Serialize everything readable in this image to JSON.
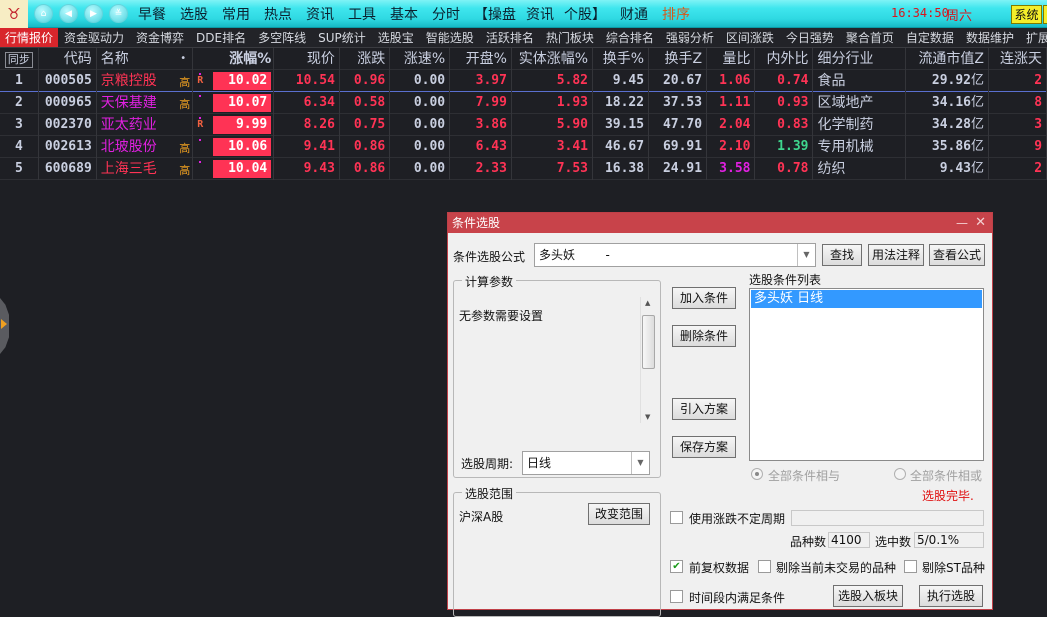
{
  "topbar": {
    "logo_icon": "bull-logo-icon",
    "nav_buttons": [
      {
        "icon": "home-icon",
        "glyph": "⌂"
      },
      {
        "icon": "back-icon",
        "glyph": "◀"
      },
      {
        "icon": "forward-icon",
        "glyph": "▶"
      },
      {
        "icon": "expand-down-icon",
        "glyph": "≚"
      }
    ],
    "menu": [
      "早餐",
      "选股",
      "常用",
      "热点",
      "资讯",
      "工具",
      "基本",
      "分时",
      "【操盘",
      "资讯",
      "个股】",
      "财通",
      "排序"
    ],
    "clock": "16:34:50",
    "weekday": "周六",
    "system_button": "系统"
  },
  "tabs": [
    "行情报价",
    "资金驱动力",
    "资金博弈",
    "DDE排名",
    "多空阵线",
    "SUP统计",
    "选股宝",
    "智能选股",
    "活跃排名",
    "热门板块",
    "综合排名",
    "强弱分析",
    "区间涨跌",
    "今日强势",
    "聚合首页",
    "自定数据",
    "数据维护",
    "扩展"
  ],
  "table": {
    "sync_label": "同步",
    "columns": [
      "代码",
      "名称",
      "涨幅%",
      "现价",
      "涨跌",
      "涨速%",
      "开盘%",
      "实体涨幅%",
      "换手%",
      "换手Z",
      "量比",
      "内外比",
      "细分行业",
      "流通市值Z",
      "连涨天"
    ],
    "name_dot": "•",
    "rows": [
      {
        "idx": "1",
        "code": "000505",
        "name": "京粮控股",
        "name_color": "red",
        "tag": "高",
        "flag": "R",
        "pct": "10.02",
        "price": "10.54",
        "chg": "0.96",
        "spd": "0.00",
        "open": "3.97",
        "body": "5.82",
        "to": "9.45",
        "toz": "20.67",
        "vr": "1.06",
        "vr_color": "red",
        "io": "0.74",
        "io_color": "red",
        "industry": "食品",
        "cap": "29.92",
        "cap_unit": "亿",
        "days": "2"
      },
      {
        "idx": "2",
        "code": "000965",
        "name": "天保基建",
        "name_color": "magenta",
        "tag": "高",
        "flag": "",
        "pct": "10.07",
        "price": "6.34",
        "chg": "0.58",
        "spd": "0.00",
        "open": "7.99",
        "body": "1.93",
        "to": "18.22",
        "toz": "37.53",
        "vr": "1.11",
        "vr_color": "red",
        "io": "0.93",
        "io_color": "red",
        "industry": "区域地产",
        "cap": "34.16",
        "cap_unit": "亿",
        "days": "8"
      },
      {
        "idx": "3",
        "code": "002370",
        "name": "亚太药业",
        "name_color": "magenta",
        "tag": "",
        "flag": "R",
        "pct": "9.99",
        "price": "8.26",
        "chg": "0.75",
        "spd": "0.00",
        "open": "3.86",
        "body": "5.90",
        "to": "39.15",
        "toz": "47.70",
        "vr": "2.04",
        "vr_color": "red",
        "io": "0.83",
        "io_color": "red",
        "industry": "化学制药",
        "cap": "34.28",
        "cap_unit": "亿",
        "days": "3"
      },
      {
        "idx": "4",
        "code": "002613",
        "name": "北玻股份",
        "name_color": "magenta",
        "tag": "高",
        "flag": "",
        "pct": "10.06",
        "price": "9.41",
        "chg": "0.86",
        "spd": "0.00",
        "open": "6.43",
        "body": "3.41",
        "to": "46.67",
        "toz": "69.91",
        "vr": "2.10",
        "vr_color": "red",
        "io": "1.39",
        "io_color": "green",
        "industry": "专用机械",
        "cap": "35.86",
        "cap_unit": "亿",
        "days": "9"
      },
      {
        "idx": "5",
        "code": "600689",
        "name": "上海三毛",
        "name_color": "red",
        "tag": "高",
        "flag": "",
        "pct": "10.04",
        "price": "9.43",
        "chg": "0.86",
        "spd": "0.00",
        "open": "2.33",
        "body": "7.53",
        "to": "16.38",
        "toz": "24.91",
        "vr": "3.58",
        "vr_color": "magenta",
        "io": "0.78",
        "io_color": "red",
        "industry": "纺织",
        "cap": "9.43",
        "cap_unit": "亿",
        "days": "2"
      }
    ]
  },
  "dialog": {
    "title": "条件选股",
    "minimize_glyph": "—",
    "close_glyph": "✕",
    "formula_label": "条件选股公式",
    "formula_value": "多头妖        -",
    "find_button": "查找",
    "usage_button": "用法注释",
    "view_formula_button": "查看公式",
    "params_group": "计算参数",
    "params_text": "无参数需要设置",
    "period_label": "选股周期:",
    "period_value": "日线",
    "add_condition": "加入条件",
    "delete_condition": "删除条件",
    "import_plan": "引入方案",
    "save_plan": "保存方案",
    "condition_list_label": "选股条件列表",
    "condition_list": [
      "多头妖  日线"
    ],
    "radio_and": "全部条件相与",
    "radio_or": "全部条件相或",
    "status": "选股完毕.",
    "scope_group": "选股范围",
    "scope_value": "沪深A股",
    "change_scope": "改变范围",
    "use_variable_period": "使用涨跌不定周期",
    "variable_period_value": "",
    "count_label": "品种数",
    "count_value": "4100",
    "selected_label": "选中数",
    "selected_value": "5/0.1%",
    "forward_adjust": "前复权数据",
    "forward_adjust_checked": true,
    "exclude_untraded": "剔除当前未交易的品种",
    "exclude_untraded_checked": false,
    "exclude_st": "剔除ST品种",
    "exclude_st_checked": false,
    "period_satisfy": "时间段内满足条件",
    "period_satisfy_checked": false,
    "to_block_button": "选股入板块",
    "execute_button": "执行选股"
  },
  "colors": {
    "up_red": "#ff3355",
    "down_green": "#3fd68e",
    "accent_magenta": "#e020e0",
    "active_tab": "#d8262c",
    "dialog_title": "#c8434a",
    "selection_blue": "#3399ff"
  }
}
